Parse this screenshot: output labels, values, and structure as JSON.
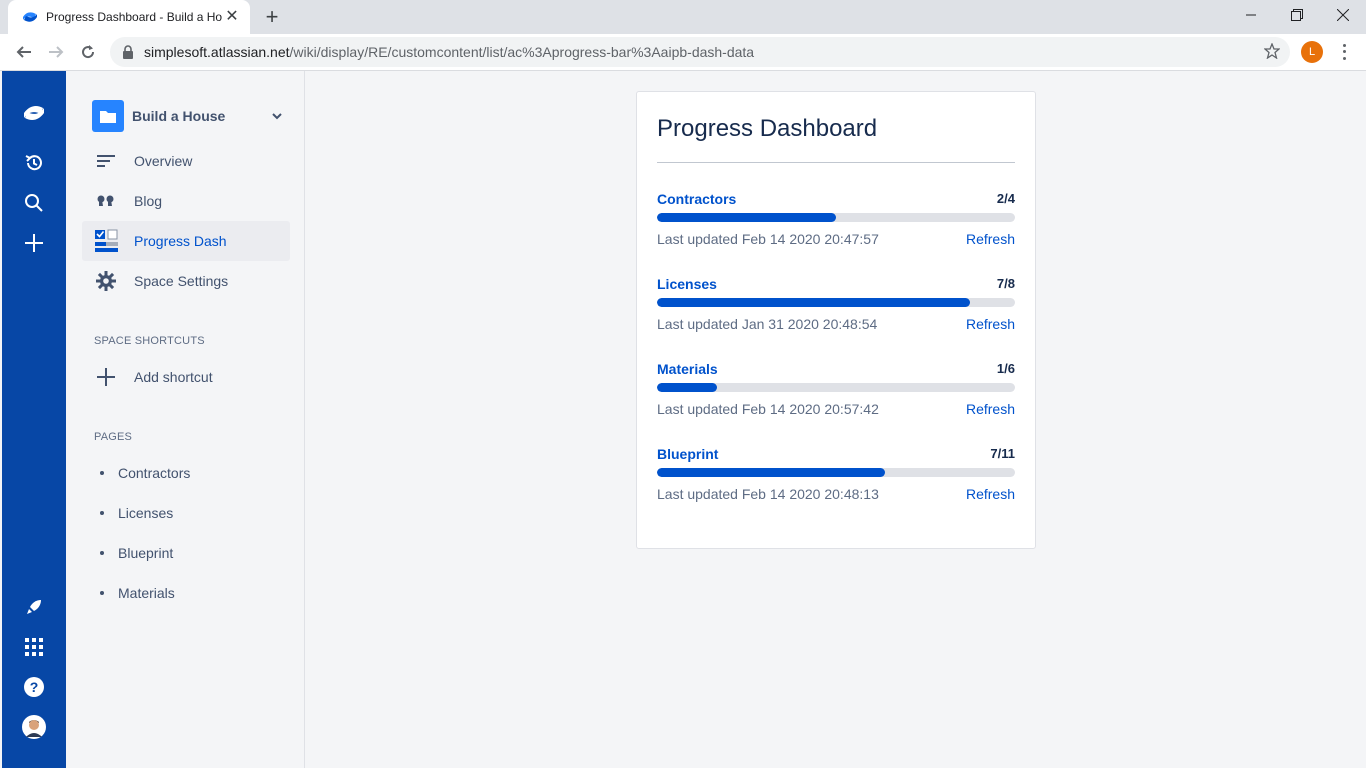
{
  "browser": {
    "tab_title": "Progress Dashboard - Build a Ho",
    "url_host": "simplesoft.atlassian.net",
    "url_path": "/wiki/display/RE/customcontent/list/ac%3Aprogress-bar%3Aaipb-dash-data",
    "profile_initial": "L"
  },
  "sidebar": {
    "space_name": "Build a House",
    "nav": [
      {
        "label": "Overview",
        "icon": "lines-icon"
      },
      {
        "label": "Blog",
        "icon": "quote-icon"
      },
      {
        "label": "Progress Dash",
        "icon": "progress-app-icon"
      },
      {
        "label": "Space Settings",
        "icon": "gear-icon"
      }
    ],
    "shortcuts_heading": "SPACE SHORTCUTS",
    "add_shortcut": "Add shortcut",
    "pages_heading": "PAGES",
    "pages": [
      "Contractors",
      "Licenses",
      "Blueprint",
      "Materials"
    ]
  },
  "dashboard": {
    "title": "Progress Dashboard",
    "items": [
      {
        "name": "Contractors",
        "count": "2/4",
        "progress": 0.5,
        "updated": "Last updated Feb 14 2020 20:47:57",
        "refresh": "Refresh"
      },
      {
        "name": "Licenses",
        "count": "7/8",
        "progress": 0.875,
        "updated": "Last updated Jan 31 2020 20:48:54",
        "refresh": "Refresh"
      },
      {
        "name": "Materials",
        "count": "1/6",
        "progress": 0.1667,
        "updated": "Last updated Feb 14 2020 20:57:42",
        "refresh": "Refresh"
      },
      {
        "name": "Blueprint",
        "count": "7/11",
        "progress": 0.6364,
        "updated": "Last updated Feb 14 2020 20:48:13",
        "refresh": "Refresh"
      }
    ]
  },
  "colors": {
    "global_nav": "#0747a6",
    "link": "#0052cc",
    "bar_track": "#dfe1e6"
  }
}
